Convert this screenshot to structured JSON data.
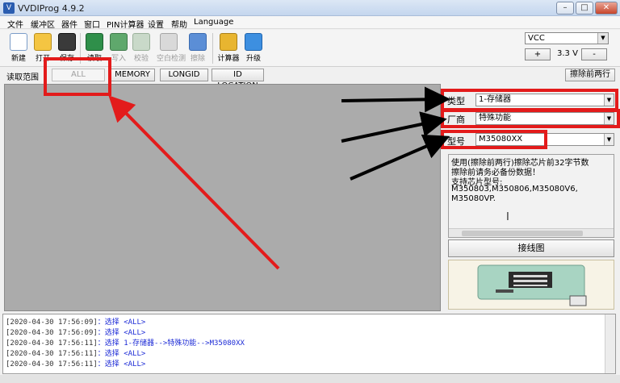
{
  "window": {
    "title": "VVDIProg 4.9.2",
    "app_icon_glyph": "V",
    "min_glyph": "–",
    "max_glyph": "□",
    "close_glyph": "✕"
  },
  "menu": [
    "文件",
    "缓冲区",
    "器件",
    "窗口",
    "PIN计算器",
    "设置",
    "帮助",
    "Language"
  ],
  "toolbar": {
    "new": "新建",
    "open": "打开",
    "save": "保存",
    "read": "读取",
    "write": "写入",
    "verify": "校验",
    "blank_check": "空白检测",
    "erase": "擦除",
    "calculator": "计算器",
    "upgrade": "升级"
  },
  "voltage": {
    "supply": "VCC",
    "plus": "+",
    "value": "3.3 V",
    "minus": "-"
  },
  "read_range": {
    "label": "读取范围",
    "buttons": [
      "ALL",
      "MEMORY",
      "LONGID",
      "ID LOCATION"
    ],
    "erase_first_two": "擦除前两行"
  },
  "device": {
    "type_label": "类型",
    "type_value": "1-存储器",
    "vendor_label": "厂商",
    "vendor_value": "特殊功能",
    "model_label": "型号",
    "model_value": "M35080XX"
  },
  "description_lines": [
    "使用(擦除前两行)擦除芯片前32字节数",
    "擦除前请务必备份数据！",
    "支持芯片型号:",
    "M350803,M350806,M35080V6,",
    "M35080VP."
  ],
  "wiring_button": "接线图",
  "log": [
    {
      "ts": "[2020-04-30 17:56:09]",
      "msg": "：选择 <ALL>"
    },
    {
      "ts": "[2020-04-30 17:56:09]",
      "msg": "：选择 <ALL>"
    },
    {
      "ts": "[2020-04-30 17:56:11]",
      "msg": "：选择 1-存储器-->特殊功能-->M35080XX"
    },
    {
      "ts": "[2020-04-30 17:56:11]",
      "msg": "：选择 <ALL>"
    },
    {
      "ts": "[2020-04-30 17:56:11]",
      "msg": "：选择 <ALL>"
    }
  ],
  "colors": {
    "annotation": "#e31b1b",
    "log_text": "#1d2bd6",
    "hex_bg": "#ababab"
  }
}
